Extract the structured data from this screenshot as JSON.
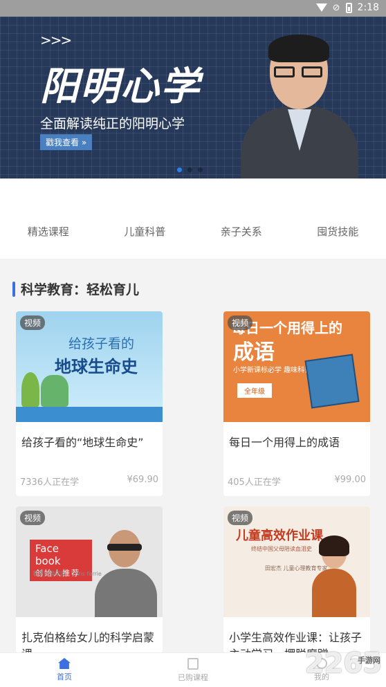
{
  "status_bar": {
    "time": "2:18"
  },
  "banner": {
    "arrows": ">>>",
    "title": "阳明心学",
    "subtitle": "全面解读纯正的阳明心学",
    "cta": "戳我查看 »"
  },
  "tabs": [
    "精选课程",
    "儿童科普",
    "亲子关系",
    "囤货技能"
  ],
  "section": {
    "title": "科学教育：轻松育儿"
  },
  "cards": [
    {
      "badge": "视频",
      "cover_line1": "给孩子看的",
      "cover_line2": "地球生命史",
      "title": "给孩子看的“地球生命史”",
      "learners": "7336人正在学",
      "price": "¥69.90"
    },
    {
      "badge": "视频",
      "cover_line1": "每日一个用得上的",
      "cover_line2": "成语",
      "cover_line3": "小学新课标必学 趣味科普",
      "cover_pill": "全年级",
      "title": "每日一个用得上的成语",
      "learners": "405人正在学",
      "price": "¥99.00"
    },
    {
      "badge": "视频",
      "cover_line1": "Face book",
      "cover_line2": "创始人推荐",
      "cover_caption": "著名物理学家 · Chris ferrie",
      "title": "扎克伯格给女儿的科学启蒙课"
    },
    {
      "badge": "视频",
      "cover_line1": "儿童高效作业课",
      "cover_line2": "终结中国父母陪读血泪史",
      "cover_line3": "田宏杰 儿童心理教育专家",
      "title": "小学生高效作业课：让孩子主动学习，摆脱磨蹭"
    }
  ],
  "bottom_nav": [
    {
      "label": "首页",
      "icon": "home-icon",
      "active": true
    },
    {
      "label": "已购课程",
      "icon": "bag-icon",
      "active": false
    },
    {
      "label": "我的",
      "icon": "user-icon",
      "active": false
    }
  ],
  "watermark": {
    "text": "2265",
    "sub": "手游网"
  },
  "colors": {
    "accent": "#3c6fe0",
    "banner_bg": "#27395a"
  }
}
